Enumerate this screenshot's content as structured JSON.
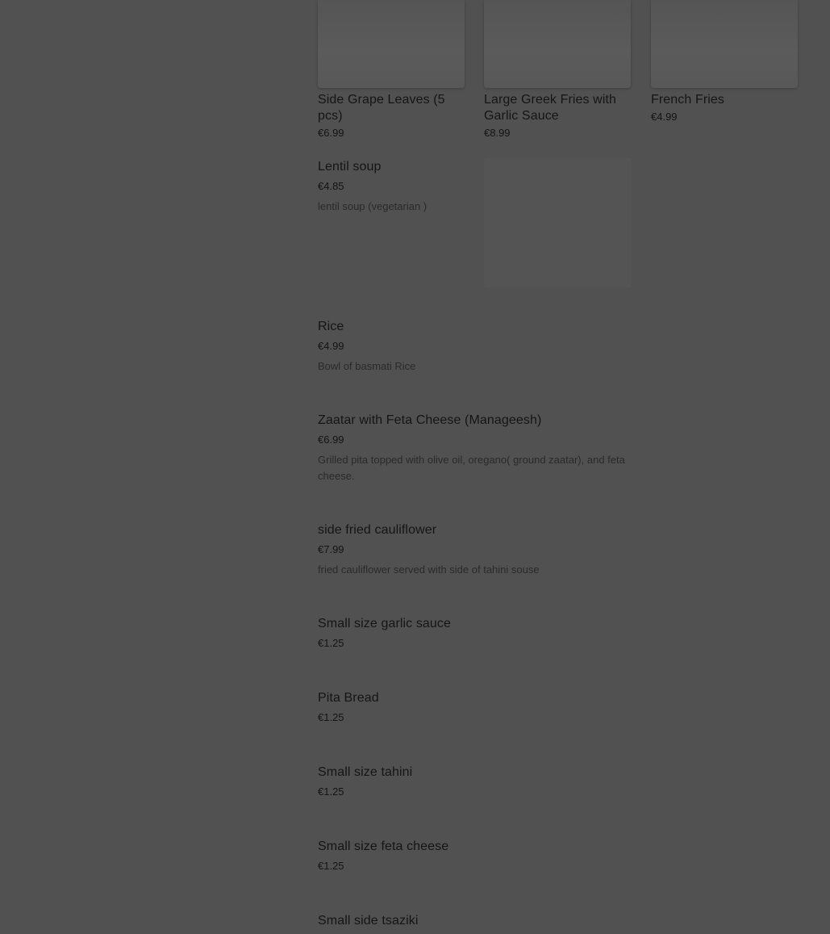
{
  "featured": [
    {
      "name": "Side Grape Leaves (5 pcs)",
      "price": "€6.99"
    },
    {
      "name": "Large Greek Fries with Garlic Sauce",
      "price": "€8.99"
    },
    {
      "name": "French Fries",
      "price": "€4.99"
    }
  ],
  "menu_items": [
    {
      "name": "Lentil soup",
      "price": "€4.85",
      "description": "lentil soup (vegetarian )"
    },
    {
      "name": "Rice",
      "price": "€4.99",
      "description": "Bowl of basmati Rice"
    },
    {
      "name": "Zaatar with Feta Cheese (Manageesh)",
      "price": "€6.99",
      "description": "Grilled pita topped with olive oil, oregano( ground zaatar), and feta cheese."
    },
    {
      "name": "side fried cauliflower",
      "price": "€7.99",
      "description": "fried cauliflower served with side of tahini souse"
    },
    {
      "name": "Small size garlic sauce",
      "price": "€1.25",
      "description": ""
    },
    {
      "name": "Pita Bread",
      "price": "€1.25",
      "description": ""
    },
    {
      "name": "Small size tahini",
      "price": "€1.25",
      "description": ""
    },
    {
      "name": "Small size feta cheese",
      "price": "€1.25",
      "description": ""
    },
    {
      "name": "Small side tsaziki",
      "price": "",
      "description": ""
    }
  ]
}
